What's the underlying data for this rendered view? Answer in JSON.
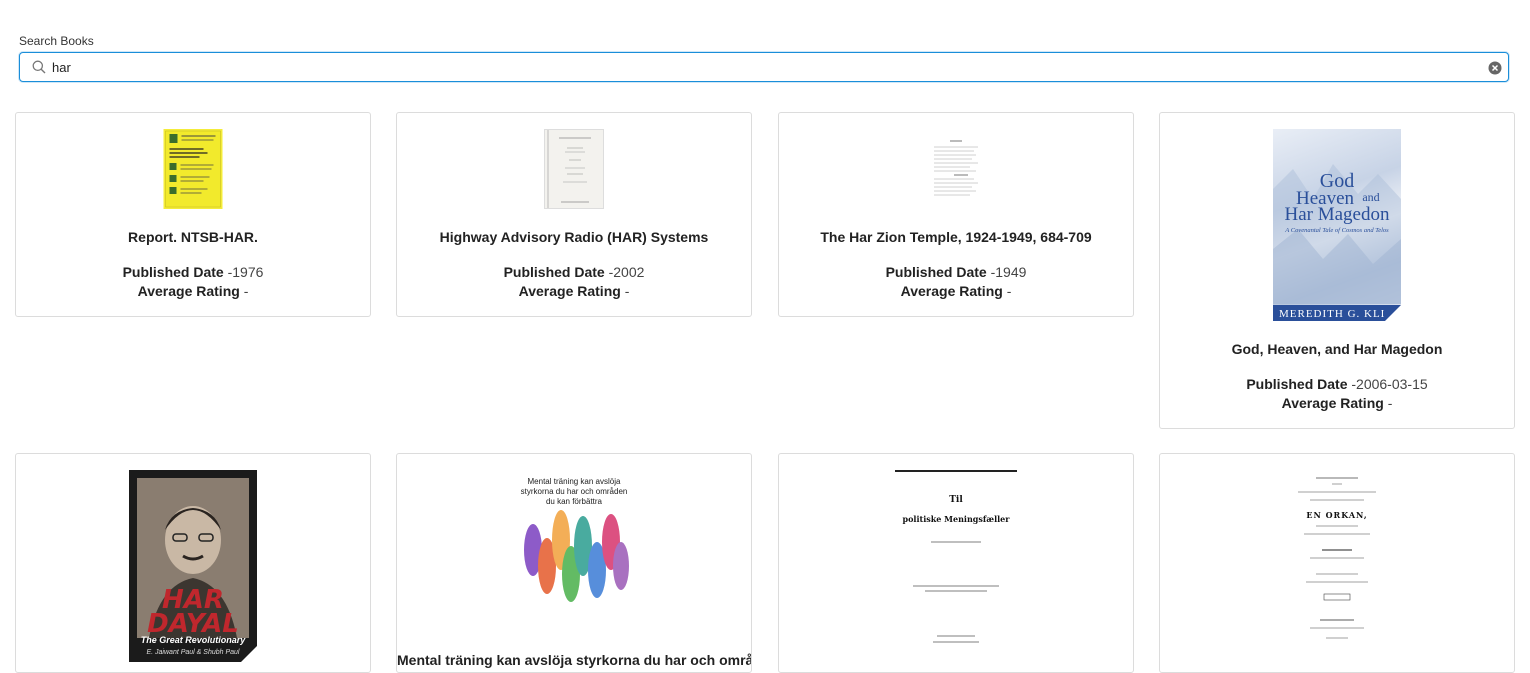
{
  "search": {
    "label": "Search Books",
    "value": "har"
  },
  "books": [
    {
      "title": "Report. NTSB-HAR.",
      "published_label": "Published Date",
      "published_value": "-1976",
      "rating_label": "Average Rating",
      "rating_value": "-"
    },
    {
      "title": "Highway Advisory Radio (HAR) Systems",
      "published_label": "Published Date",
      "published_value": "-2002",
      "rating_label": "Average Rating",
      "rating_value": "-"
    },
    {
      "title": "The Har Zion Temple, 1924-1949, 684-709",
      "published_label": "Published Date",
      "published_value": "-1949",
      "rating_label": "Average Rating",
      "rating_value": "-"
    },
    {
      "title": "God, Heaven, and Har Magedon",
      "published_label": "Published Date",
      "published_value": "-2006-03-15",
      "rating_label": "Average Rating",
      "rating_value": "-",
      "cover_text": {
        "line1": "God",
        "line2": "Heaven",
        "line2b": "and",
        "line3": "Har Magedon",
        "subtitle": "A Covenantal Tale of Cosmos and Telos",
        "author": "MEREDITH G. KLI"
      }
    },
    {
      "title": "",
      "cover_text": {
        "line1": "HAR",
        "line2": "DAYAL",
        "subtitle": "The Great Revolutionary",
        "author": "E. Jaiwant Paul & Shubh Paul"
      }
    },
    {
      "title": "Mental träning kan avslöja styrkorna du har och områden du kan förbättra",
      "cover_text": {
        "line1": "Mental träning kan avslöja",
        "line2": "styrkorna du har och områden",
        "line3": "du kan förbättra"
      }
    },
    {
      "title": "",
      "cover_text": {
        "line1": "Til",
        "line2": "politiske Meningsfæller"
      }
    },
    {
      "title": "",
      "cover_text": {
        "line1": "EN ORKAN,"
      }
    }
  ],
  "colors": {
    "accent": "#1a8ed9",
    "card_border": "#dcdcdc"
  }
}
